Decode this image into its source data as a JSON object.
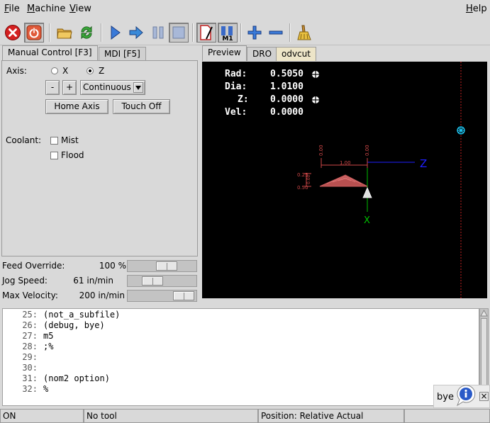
{
  "menubar": {
    "file": {
      "mn": "F",
      "rest": "ile"
    },
    "machine": {
      "mn": "M",
      "rest": "achine"
    },
    "view": {
      "mn": "V",
      "rest": "iew"
    },
    "help": {
      "mn": "H",
      "rest": "elp"
    }
  },
  "toolbar": {
    "icons": [
      "estop-icon",
      "power-icon",
      "open-folder-icon",
      "reload-icon",
      "run-icon",
      "step-icon",
      "pause-icon",
      "stop-icon",
      "block-delete-icon",
      "optional-stop-icon",
      "zoom-in-icon",
      "zoom-out-icon",
      "clear-plot-icon"
    ],
    "optional_stop_label": "M1"
  },
  "left_tabs": [
    {
      "label": "Manual Control [F3]",
      "active": true
    },
    {
      "label": "MDI [F5]",
      "active": false
    }
  ],
  "right_tabs": [
    {
      "label": "Preview",
      "active": true
    },
    {
      "label": "DRO",
      "active": false
    },
    {
      "label": "odvcut",
      "active": false
    }
  ],
  "manual": {
    "axis_label": "Axis:",
    "axis_x": "X",
    "axis_z": "Z",
    "selected_axis": "Z",
    "minus_label": "-",
    "plus_label": "+",
    "jog_increment": "Continuous",
    "home_axis": "Home Axis",
    "touch_off": "Touch Off",
    "coolant_label": "Coolant:",
    "mist": "Mist",
    "flood": "Flood"
  },
  "overrides": {
    "feed_label": "Feed Override:",
    "feed_value": "100 %",
    "feed_level": 0.6,
    "jog_label": "Jog Speed:",
    "jog_value": "61 in/min",
    "jog_level": 0.3,
    "maxvel_label": "Max Velocity:",
    "maxvel_value": "200 in/min",
    "maxvel_level": 0.95
  },
  "dro": {
    "rad_label": "Rad:",
    "rad_value": "0.5050",
    "dia_label": "Dia:",
    "dia_value": "1.0100",
    "z_label": "Z:",
    "z_value": "0.0000",
    "vel_label": "Vel:",
    "vel_value": "0.0000"
  },
  "preview": {
    "z_axis_label": "Z",
    "x_axis_label": "X",
    "dim_length": "1.00",
    "dim_top_left": "0.00",
    "dim_top_right": "0.00",
    "dim_side_a": "0.25",
    "dim_side_b": "0.50",
    "dim_side_c": "0.00"
  },
  "gcode_lines": [
    {
      "n": "25:",
      "code": "(not_a_subfile)"
    },
    {
      "n": "26:",
      "code": "(debug, bye)"
    },
    {
      "n": "27:",
      "code": "m5"
    },
    {
      "n": "28:",
      "code": ";%"
    },
    {
      "n": "29:",
      "code": ""
    },
    {
      "n": "30:",
      "code": ""
    },
    {
      "n": "31:",
      "code": "(nom2 option)"
    },
    {
      "n": "32:",
      "code": "%"
    }
  ],
  "notification": {
    "text": "bye",
    "close": "×"
  },
  "status": {
    "machine": "ON",
    "tool": "No tool",
    "position": "Position: Relative Actual"
  },
  "colors": {
    "preview_bg": "#000000",
    "z_axis": "#2020ff",
    "x_axis": "#00c000",
    "dimension": "#d04848",
    "toolpath": "#b85050",
    "limit_line": "#c02020",
    "origin_marker": "#20d0ff"
  }
}
